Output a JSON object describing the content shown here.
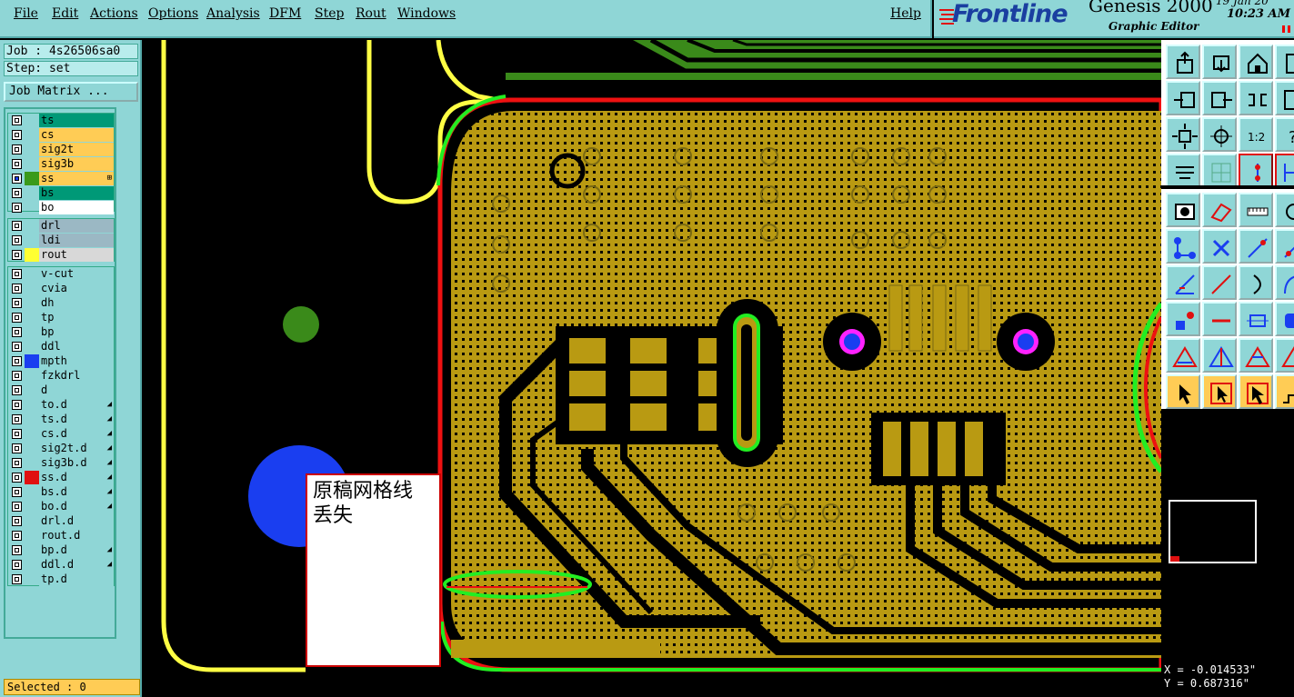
{
  "menubar": {
    "items": [
      "File",
      "Edit",
      "Actions",
      "Options",
      "Analysis",
      "DFM",
      "Step",
      "Rout",
      "Windows"
    ],
    "help": "Help"
  },
  "brand": {
    "logo": "Frontline",
    "product": "Genesis 2000",
    "subtitle": "Graphic Editor",
    "date": "19 Jan 20",
    "time": "10:23 AM"
  },
  "job": {
    "job_label": "Job : 4s26506sa0",
    "step_label": "Step: set",
    "matrix_button": "Job Matrix ..."
  },
  "layers": {
    "group1": [
      {
        "name": "ts",
        "color": "#009977",
        "swatch": "",
        "flag": ""
      },
      {
        "name": "cs",
        "color": "#ffcc55",
        "swatch": "",
        "flag": ""
      },
      {
        "name": "sig2t",
        "color": "#ffcc55",
        "swatch": "",
        "flag": ""
      },
      {
        "name": "sig3b",
        "color": "#ffcc55",
        "swatch": "",
        "flag": ""
      },
      {
        "name": "ss",
        "color": "#ffcc55",
        "swatch": "#3a9a1a",
        "flag": "⊞",
        "active": true
      },
      {
        "name": "bs",
        "color": "#009977",
        "swatch": "",
        "flag": ""
      },
      {
        "name": "bo",
        "color": "#ffffff",
        "swatch": "",
        "flag": ""
      }
    ],
    "group2": [
      {
        "name": "drl",
        "color": "#9bb8c4",
        "swatch": "",
        "flag": ""
      },
      {
        "name": "ldi",
        "color": "#9bb8c4",
        "swatch": "",
        "flag": ""
      },
      {
        "name": "rout",
        "color": "#d8d8d8",
        "swatch": "#ffff33",
        "flag": ""
      }
    ],
    "group3": [
      {
        "name": "v-cut",
        "color": "#8fd6d6",
        "swatch": "",
        "flag": ""
      },
      {
        "name": "cvia",
        "color": "#8fd6d6",
        "swatch": "",
        "flag": ""
      },
      {
        "name": "dh",
        "color": "#8fd6d6",
        "swatch": "",
        "flag": ""
      },
      {
        "name": "tp",
        "color": "#8fd6d6",
        "swatch": "",
        "flag": ""
      },
      {
        "name": "bp",
        "color": "#8fd6d6",
        "swatch": "",
        "flag": ""
      },
      {
        "name": "ddl",
        "color": "#8fd6d6",
        "swatch": "",
        "flag": ""
      },
      {
        "name": "mpth",
        "color": "#8fd6d6",
        "swatch": "#1a3ef0",
        "flag": ""
      },
      {
        "name": "fzkdrl",
        "color": "#8fd6d6",
        "swatch": "",
        "flag": ""
      },
      {
        "name": "d",
        "color": "#8fd6d6",
        "swatch": "",
        "flag": ""
      },
      {
        "name": "to.d",
        "color": "#8fd6d6",
        "swatch": "",
        "flag": "◢"
      },
      {
        "name": "ts.d",
        "color": "#8fd6d6",
        "swatch": "",
        "flag": "◢"
      },
      {
        "name": "cs.d",
        "color": "#8fd6d6",
        "swatch": "",
        "flag": "◢"
      },
      {
        "name": "sig2t.d",
        "color": "#8fd6d6",
        "swatch": "",
        "flag": "◢"
      },
      {
        "name": "sig3b.d",
        "color": "#8fd6d6",
        "swatch": "",
        "flag": "◢"
      },
      {
        "name": "ss.d",
        "color": "#8fd6d6",
        "swatch": "#e01010",
        "flag": "◢"
      },
      {
        "name": "bs.d",
        "color": "#8fd6d6",
        "swatch": "",
        "flag": "◢"
      },
      {
        "name": "bo.d",
        "color": "#8fd6d6",
        "swatch": "",
        "flag": "◢"
      },
      {
        "name": "drl.d",
        "color": "#8fd6d6",
        "swatch": "",
        "flag": ""
      },
      {
        "name": "rout.d",
        "color": "#8fd6d6",
        "swatch": "",
        "flag": ""
      },
      {
        "name": "bp.d",
        "color": "#8fd6d6",
        "swatch": "",
        "flag": "◢"
      },
      {
        "name": "ddl.d",
        "color": "#8fd6d6",
        "swatch": "",
        "flag": "◢"
      },
      {
        "name": "tp.d",
        "color": "#8fd6d6",
        "swatch": "",
        "flag": ""
      }
    ]
  },
  "status": {
    "selected": "Selected : 0"
  },
  "annotation": {
    "text": "原稿网格线\n丢失"
  },
  "toolbar": {
    "icons": [
      "open-job-icon",
      "save-job-icon",
      "home-icon",
      "clipboard-icon",
      "move-left-icon",
      "move-right-icon",
      "mirror-icon",
      "zoom-in-icon",
      "fit-view-icon",
      "center-view-icon",
      "scale-1-2-icon",
      "help-question-icon",
      "measure-icon",
      "snap-icon",
      "grid-icon",
      "connect-nodes-icon",
      "add-pad-icon",
      "add-shape-icon",
      "ruler-icon",
      "extra-icon",
      "nodes-icon",
      "cross-icon",
      "line-node-icon",
      "line-node-2-icon",
      "angle-icon",
      "diagonal-line-icon",
      "arc-icon",
      "arc-2-icon",
      "node-square-icon",
      "dash-line-icon",
      "dimension-icon",
      "pad-shape-icon",
      "triangle-icon",
      "triangle-2-icon",
      "triangle-3-icon",
      "triangle-4-icon",
      "select-arrow-icon",
      "select-box-icon",
      "select-arrow-2-icon",
      "step-icon"
    ]
  },
  "cursor": {
    "x": "X = -0.014533\"",
    "y": "Y =  0.687316\""
  },
  "colors": {
    "panel": "#8fd6d6",
    "board_yellow": "#b99a12",
    "board_green": "#3a8a1a",
    "outline_red": "#ee1111",
    "highlight_green": "#22ee22",
    "rout_yellow": "#ffff44",
    "drill_blue": "#1a3ef0",
    "drill_magenta": "#ff22ff"
  }
}
